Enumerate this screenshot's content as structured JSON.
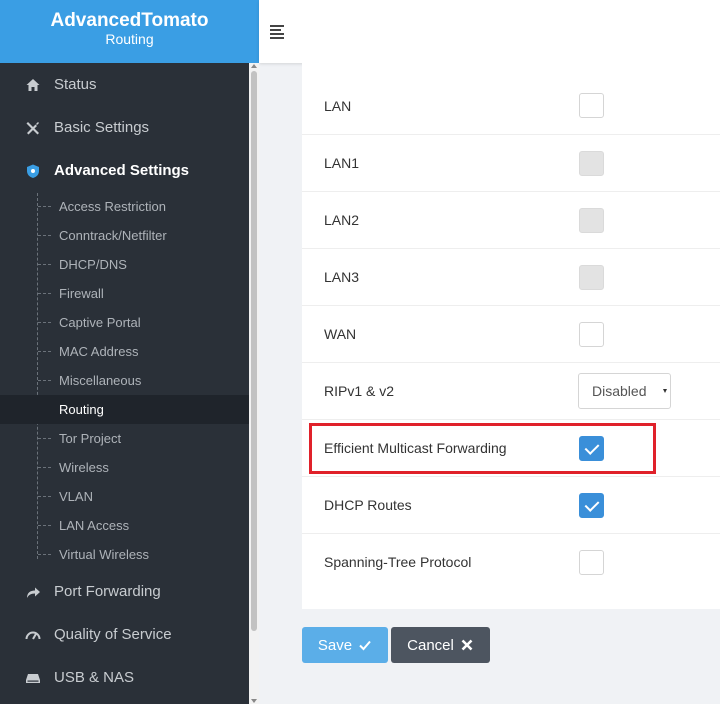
{
  "brand": {
    "name": "AdvancedTomato",
    "subtitle": "Routing"
  },
  "colors": {
    "brand": "#3a9ee4",
    "sidebar": "#2a3038",
    "checkbox_checked": "#3a8fd9",
    "highlight": "#e0212a",
    "save": "#5baee8",
    "cancel": "#4d5560"
  },
  "sidebar": {
    "status": "Status",
    "basic": "Basic Settings",
    "advanced": "Advanced Settings",
    "sub": [
      "Access Restriction",
      "Conntrack/Netfilter",
      "DHCP/DNS",
      "Firewall",
      "Captive Portal",
      "MAC Address",
      "Miscellaneous",
      "Routing",
      "Tor Project",
      "Wireless",
      "VLAN",
      "LAN Access",
      "Virtual Wireless"
    ],
    "port_forwarding": "Port Forwarding",
    "qos": "Quality of Service",
    "usb": "USB & NAS"
  },
  "rows": {
    "lan": {
      "label": "LAN",
      "state": "unchecked"
    },
    "lan1": {
      "label": "LAN1",
      "state": "disabled"
    },
    "lan2": {
      "label": "LAN2",
      "state": "disabled"
    },
    "lan3": {
      "label": "LAN3",
      "state": "disabled"
    },
    "wan": {
      "label": "WAN",
      "state": "unchecked"
    },
    "rip": {
      "label": "RIPv1 & v2",
      "value": "Disabled"
    },
    "emf": {
      "label": "Efficient Multicast Forwarding",
      "state": "checked"
    },
    "dhcp": {
      "label": "DHCP Routes",
      "state": "checked"
    },
    "stp": {
      "label": "Spanning-Tree Protocol",
      "state": "unchecked"
    }
  },
  "buttons": {
    "save": "Save",
    "cancel": "Cancel"
  }
}
